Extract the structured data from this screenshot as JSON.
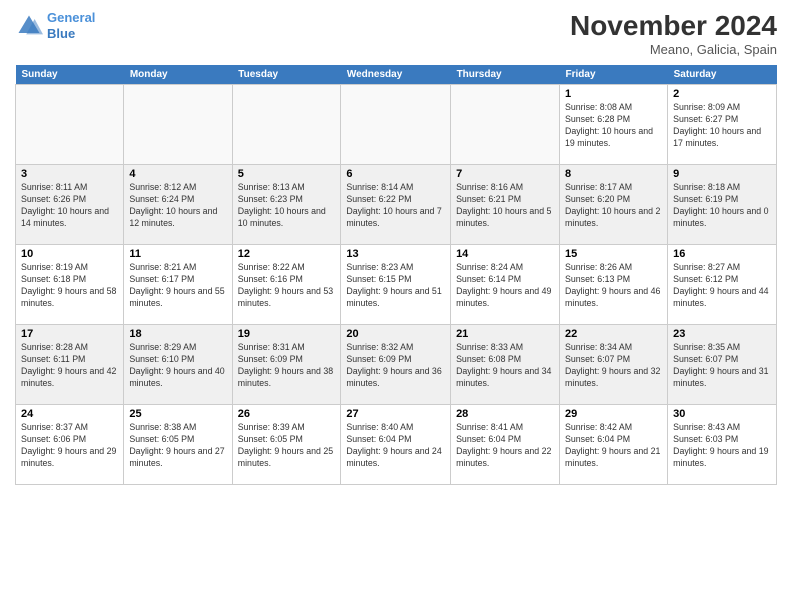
{
  "logo": {
    "line1": "General",
    "line2": "Blue"
  },
  "title": "November 2024",
  "location": "Meano, Galicia, Spain",
  "weekdays": [
    "Sunday",
    "Monday",
    "Tuesday",
    "Wednesday",
    "Thursday",
    "Friday",
    "Saturday"
  ],
  "weeks": [
    [
      {
        "day": "",
        "info": ""
      },
      {
        "day": "",
        "info": ""
      },
      {
        "day": "",
        "info": ""
      },
      {
        "day": "",
        "info": ""
      },
      {
        "day": "",
        "info": ""
      },
      {
        "day": "1",
        "info": "Sunrise: 8:08 AM\nSunset: 6:28 PM\nDaylight: 10 hours and 19 minutes."
      },
      {
        "day": "2",
        "info": "Sunrise: 8:09 AM\nSunset: 6:27 PM\nDaylight: 10 hours and 17 minutes."
      }
    ],
    [
      {
        "day": "3",
        "info": "Sunrise: 8:11 AM\nSunset: 6:26 PM\nDaylight: 10 hours and 14 minutes."
      },
      {
        "day": "4",
        "info": "Sunrise: 8:12 AM\nSunset: 6:24 PM\nDaylight: 10 hours and 12 minutes."
      },
      {
        "day": "5",
        "info": "Sunrise: 8:13 AM\nSunset: 6:23 PM\nDaylight: 10 hours and 10 minutes."
      },
      {
        "day": "6",
        "info": "Sunrise: 8:14 AM\nSunset: 6:22 PM\nDaylight: 10 hours and 7 minutes."
      },
      {
        "day": "7",
        "info": "Sunrise: 8:16 AM\nSunset: 6:21 PM\nDaylight: 10 hours and 5 minutes."
      },
      {
        "day": "8",
        "info": "Sunrise: 8:17 AM\nSunset: 6:20 PM\nDaylight: 10 hours and 2 minutes."
      },
      {
        "day": "9",
        "info": "Sunrise: 8:18 AM\nSunset: 6:19 PM\nDaylight: 10 hours and 0 minutes."
      }
    ],
    [
      {
        "day": "10",
        "info": "Sunrise: 8:19 AM\nSunset: 6:18 PM\nDaylight: 9 hours and 58 minutes."
      },
      {
        "day": "11",
        "info": "Sunrise: 8:21 AM\nSunset: 6:17 PM\nDaylight: 9 hours and 55 minutes."
      },
      {
        "day": "12",
        "info": "Sunrise: 8:22 AM\nSunset: 6:16 PM\nDaylight: 9 hours and 53 minutes."
      },
      {
        "day": "13",
        "info": "Sunrise: 8:23 AM\nSunset: 6:15 PM\nDaylight: 9 hours and 51 minutes."
      },
      {
        "day": "14",
        "info": "Sunrise: 8:24 AM\nSunset: 6:14 PM\nDaylight: 9 hours and 49 minutes."
      },
      {
        "day": "15",
        "info": "Sunrise: 8:26 AM\nSunset: 6:13 PM\nDaylight: 9 hours and 46 minutes."
      },
      {
        "day": "16",
        "info": "Sunrise: 8:27 AM\nSunset: 6:12 PM\nDaylight: 9 hours and 44 minutes."
      }
    ],
    [
      {
        "day": "17",
        "info": "Sunrise: 8:28 AM\nSunset: 6:11 PM\nDaylight: 9 hours and 42 minutes."
      },
      {
        "day": "18",
        "info": "Sunrise: 8:29 AM\nSunset: 6:10 PM\nDaylight: 9 hours and 40 minutes."
      },
      {
        "day": "19",
        "info": "Sunrise: 8:31 AM\nSunset: 6:09 PM\nDaylight: 9 hours and 38 minutes."
      },
      {
        "day": "20",
        "info": "Sunrise: 8:32 AM\nSunset: 6:09 PM\nDaylight: 9 hours and 36 minutes."
      },
      {
        "day": "21",
        "info": "Sunrise: 8:33 AM\nSunset: 6:08 PM\nDaylight: 9 hours and 34 minutes."
      },
      {
        "day": "22",
        "info": "Sunrise: 8:34 AM\nSunset: 6:07 PM\nDaylight: 9 hours and 32 minutes."
      },
      {
        "day": "23",
        "info": "Sunrise: 8:35 AM\nSunset: 6:07 PM\nDaylight: 9 hours and 31 minutes."
      }
    ],
    [
      {
        "day": "24",
        "info": "Sunrise: 8:37 AM\nSunset: 6:06 PM\nDaylight: 9 hours and 29 minutes."
      },
      {
        "day": "25",
        "info": "Sunrise: 8:38 AM\nSunset: 6:05 PM\nDaylight: 9 hours and 27 minutes."
      },
      {
        "day": "26",
        "info": "Sunrise: 8:39 AM\nSunset: 6:05 PM\nDaylight: 9 hours and 25 minutes."
      },
      {
        "day": "27",
        "info": "Sunrise: 8:40 AM\nSunset: 6:04 PM\nDaylight: 9 hours and 24 minutes."
      },
      {
        "day": "28",
        "info": "Sunrise: 8:41 AM\nSunset: 6:04 PM\nDaylight: 9 hours and 22 minutes."
      },
      {
        "day": "29",
        "info": "Sunrise: 8:42 AM\nSunset: 6:04 PM\nDaylight: 9 hours and 21 minutes."
      },
      {
        "day": "30",
        "info": "Sunrise: 8:43 AM\nSunset: 6:03 PM\nDaylight: 9 hours and 19 minutes."
      }
    ]
  ]
}
